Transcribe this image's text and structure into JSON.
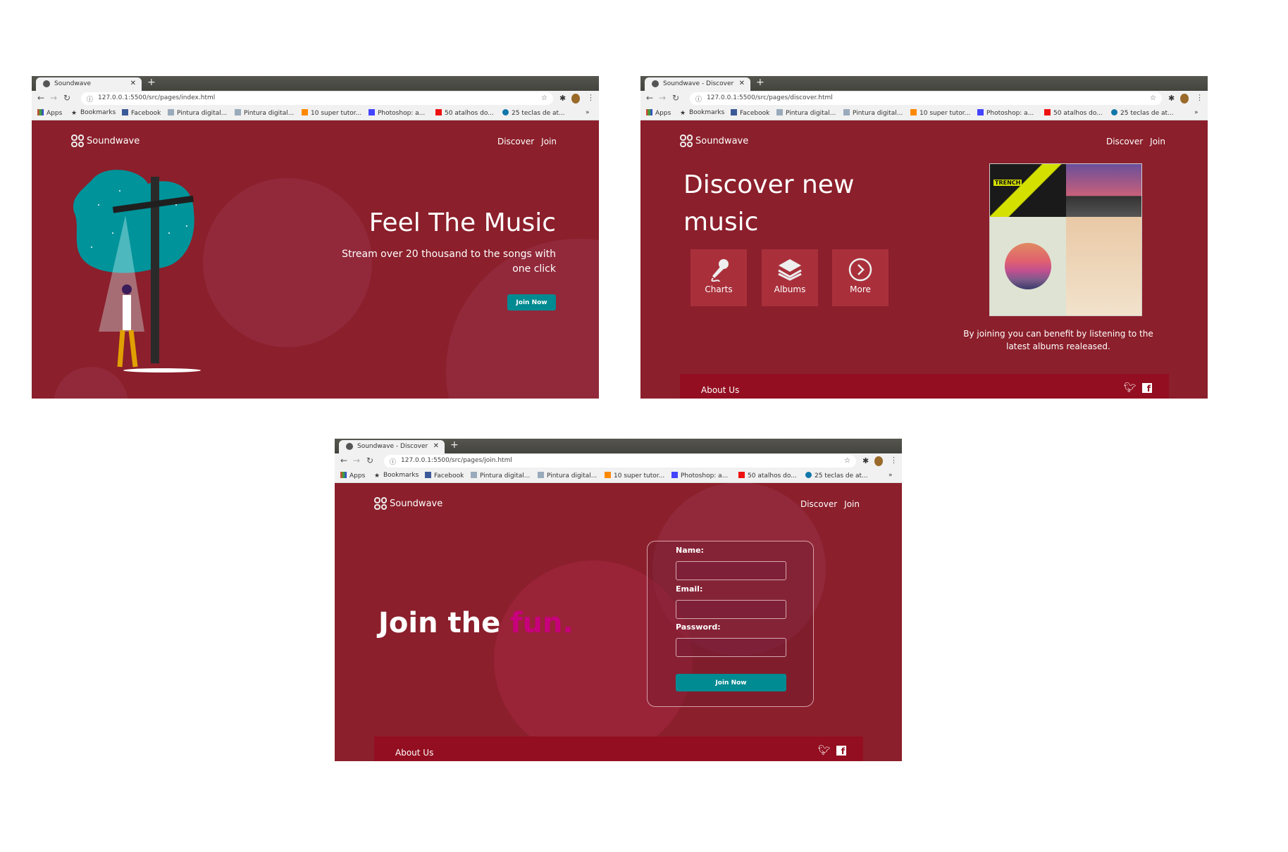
{
  "bookmarks": [
    "Apps",
    "Bookmarks",
    "Facebook",
    "Pintura digital...",
    "Pintura digital...",
    "10 super tutor...",
    "Photoshop: a...",
    "50 atalhos do...",
    "25 teclas de at..."
  ],
  "brand": "Soundwave",
  "nav": {
    "discover": "Discover",
    "join": "Join"
  },
  "home": {
    "tab_title": "Soundwave",
    "url": "127.0.0.1:5500/src/pages/index.html",
    "headline": "Feel The Music",
    "subtitle": "Stream over 20 thousand to the songs with one click",
    "cta": "Join Now"
  },
  "discover": {
    "tab_title": "Soundwave - Discover",
    "url": "127.0.0.1:5500/src/pages/discover.html",
    "headline_1": "Discover new",
    "headline_2": "music",
    "features": [
      "Charts",
      "Albums",
      "More"
    ],
    "albums_text": "By joining you can benefit by listening to the latest albums realeased.",
    "album_art_text": "TRENCH",
    "footer_about": "About Us"
  },
  "join": {
    "tab_title": "Soundwave - Discover",
    "url": "127.0.0.1:5500/src/pages/join.html",
    "headline": "Join the",
    "headline_accent": "fun.",
    "labels": {
      "name": "Name:",
      "email": "Email:",
      "password": "Password:"
    },
    "values": {
      "name": "",
      "email": "",
      "password": ""
    },
    "submit": "Join Now",
    "footer_about": "About Us"
  },
  "colors": {
    "page_bg": "#8b1f2b",
    "teal": "#008a91",
    "footer": "#930e20",
    "accent": "#c8007c",
    "feature": "#a9303b"
  }
}
